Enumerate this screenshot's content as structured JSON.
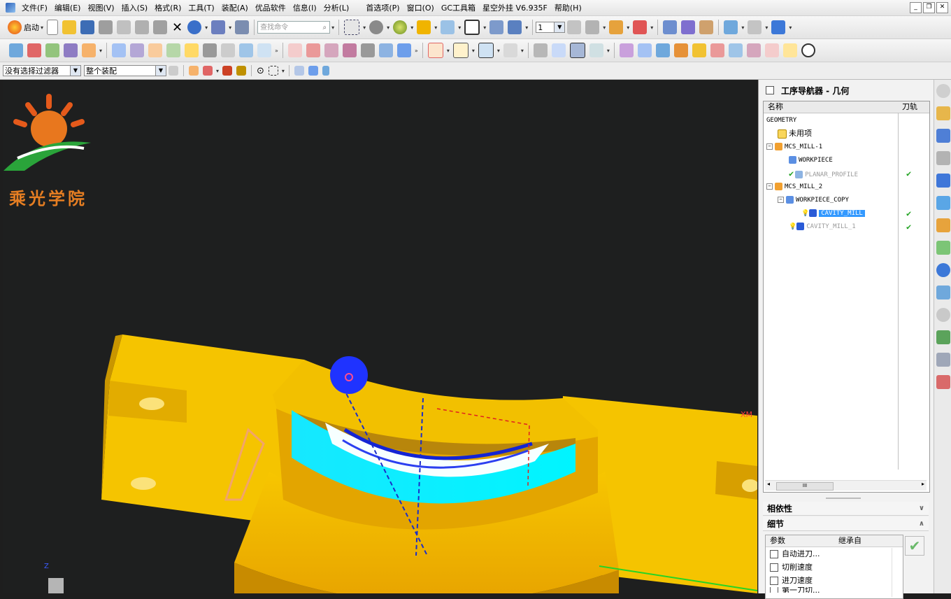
{
  "menubar": {
    "items": [
      "文件(F)",
      "编辑(E)",
      "视图(V)",
      "插入(S)",
      "格式(R)",
      "工具(T)",
      "装配(A)",
      "优品软件",
      "信息(I)",
      "分析(L)",
      "首选项(P)",
      "窗口(O)",
      "GC工具箱",
      "星空外挂 V6.935F",
      "帮助(H)"
    ]
  },
  "toolbar": {
    "start_label": "启动",
    "search_placeholder": "查找命令",
    "layer_value": "1"
  },
  "selection_bar": {
    "filter_value": "没有选择过滤器",
    "scope_value": "整个装配"
  },
  "viewport": {
    "logo_text": "乘光学院",
    "axis_label": "XM",
    "z_label": "Z"
  },
  "navigator": {
    "title": "工序导航器 - 几何",
    "col_name": "名称",
    "col_path": "刀轨",
    "rows": [
      {
        "name": "GEOMETRY"
      },
      {
        "name": "未用项"
      },
      {
        "name": "MCS_MILL-1"
      },
      {
        "name": "WORKPIECE"
      },
      {
        "name": "PLANAR_PROFILE"
      },
      {
        "name": "MCS_MILL_2"
      },
      {
        "name": "WORKPIECE_COPY"
      },
      {
        "name": "CAVITY_MILL"
      },
      {
        "name": "CAVITY_MILL_1"
      }
    ],
    "tick": "✔",
    "scroll_thumb": "III"
  },
  "sections": {
    "dependency": "相依性",
    "details": "细节"
  },
  "details": {
    "col_param": "参数",
    "col_inherit": "继承自",
    "rows": [
      "自动进刀...",
      "切削速度",
      "进刀速度",
      "第一刀切..."
    ]
  },
  "colors": {
    "part_yellow": "#f5c400",
    "cyan": "#00ffff",
    "selection_blue": "#3399ff"
  }
}
